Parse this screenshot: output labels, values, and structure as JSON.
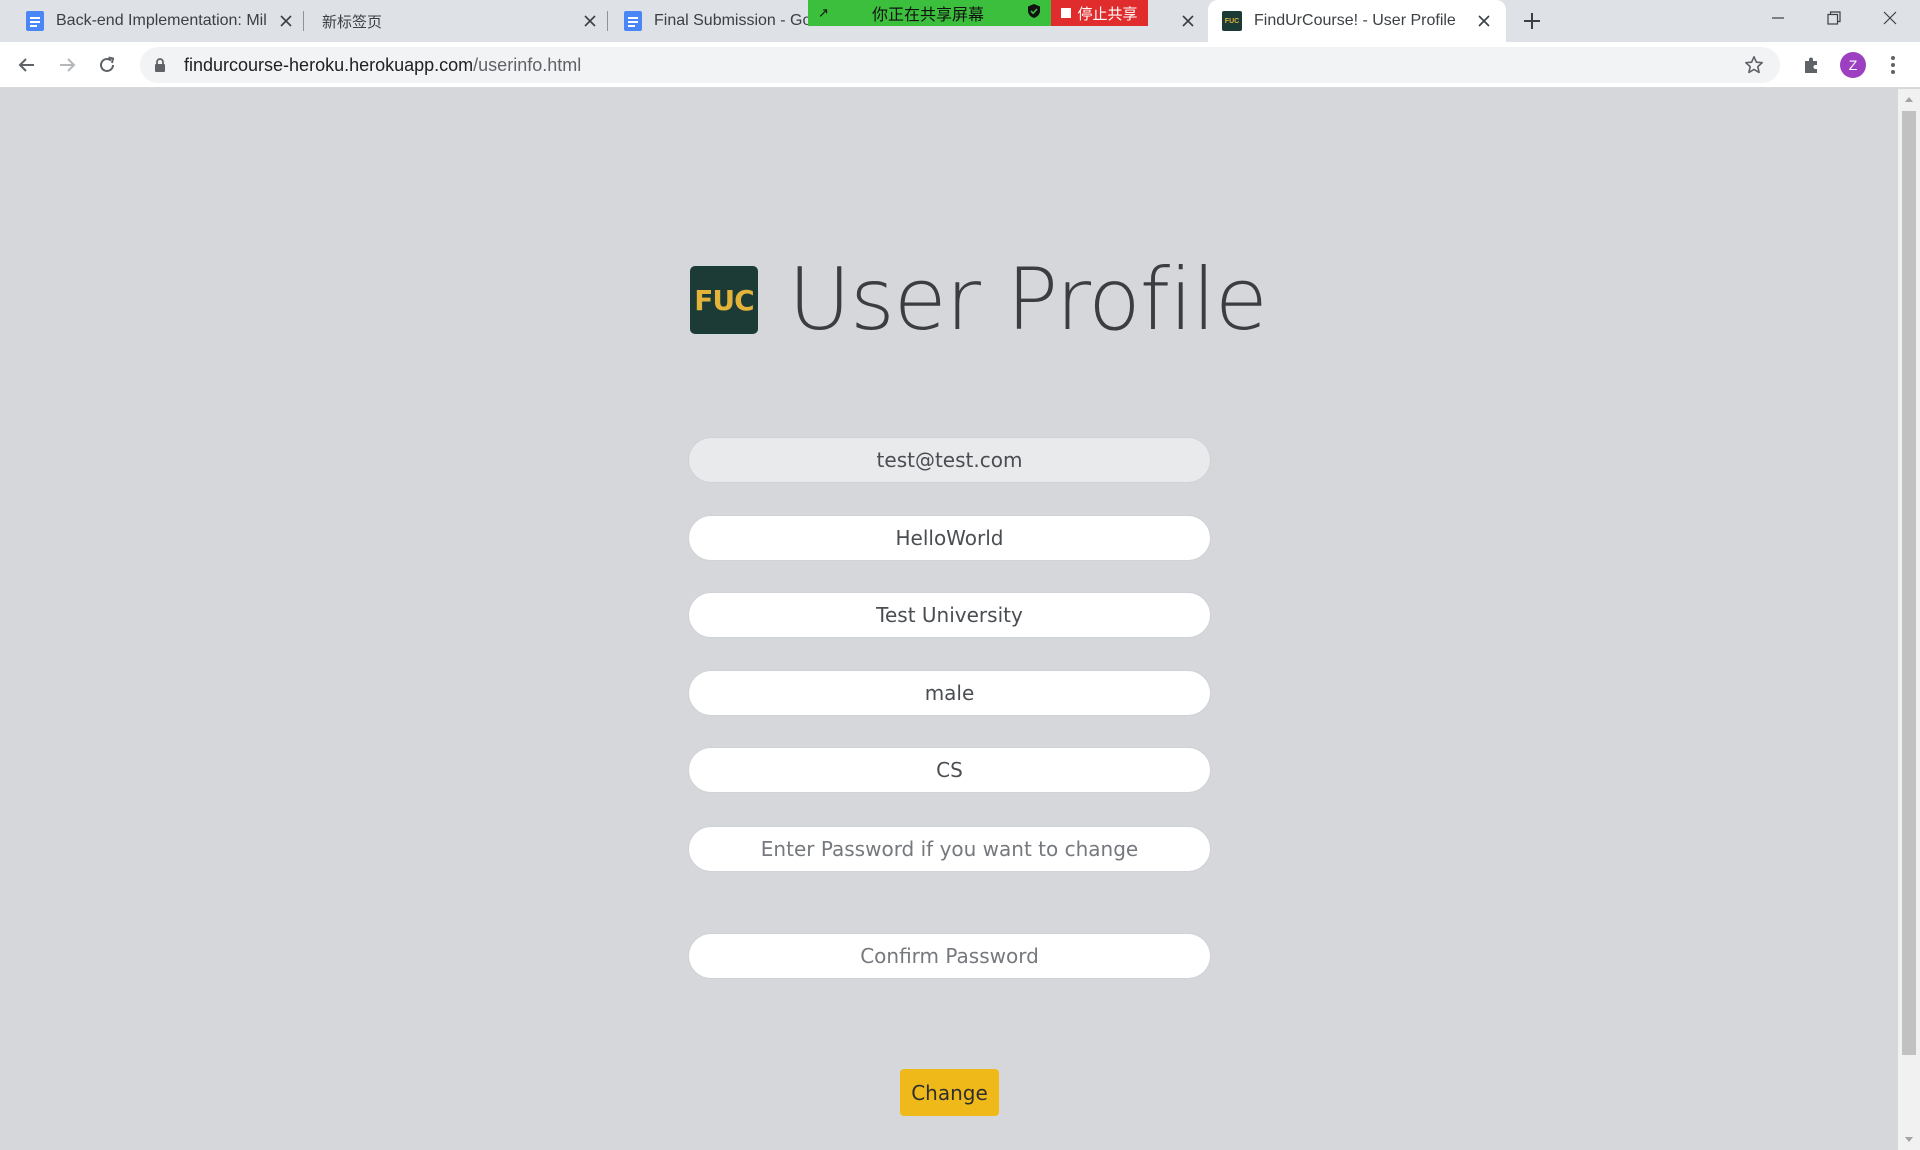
{
  "browser": {
    "tabs": [
      {
        "title": "Back-end Implementation: Mil",
        "icon": "google-docs-icon"
      },
      {
        "title": "新标签页",
        "icon": ""
      },
      {
        "title": "Final Submission - Goo",
        "icon": "google-docs-icon"
      },
      {
        "title": "FindUrCourse! - User Profile",
        "icon": "fuc-icon",
        "active": true
      }
    ],
    "share_banner": {
      "sharing_text": "你正在共享屏幕",
      "stop_label": "停止共享"
    },
    "url_host": "findurcourse-heroku.herokuapp.com",
    "url_path": "/userinfo.html",
    "avatar_letter": "Z"
  },
  "profile": {
    "logo_text": "FUC",
    "title": "User Profile",
    "email": "test@test.com",
    "username": "HelloWorld",
    "university": "Test University",
    "gender": "male",
    "major": "CS",
    "password_placeholder": "Enter Password if you want to change",
    "confirm_placeholder": "Confirm Password",
    "change_label": "Change"
  },
  "colors": {
    "page_bg": "#d6d7db",
    "logo_bg": "#1c3b36",
    "logo_text": "#e3b33a",
    "button_bg": "#f0b91a"
  }
}
